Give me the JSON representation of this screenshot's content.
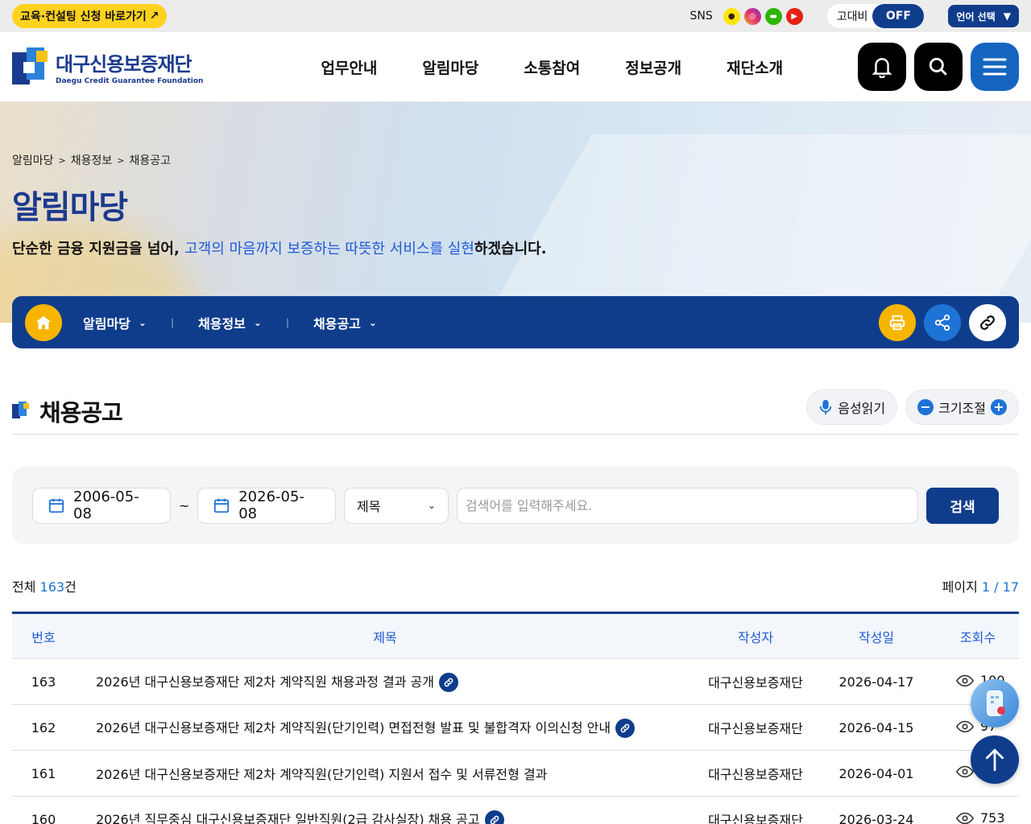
{
  "topbar": {
    "edu_link": "교육·컨설팅 신청 바로가기",
    "sns_label": "SNS",
    "contrast_label": "고대비",
    "contrast_state": "OFF",
    "language_label": "언어 선택"
  },
  "header": {
    "logo_ko": "대구신용보증재단",
    "logo_en": "Daegu Credit Guarantee Foundation",
    "nav": [
      "업무안내",
      "알림마당",
      "소통참여",
      "정보공개",
      "재단소개"
    ]
  },
  "hero": {
    "breadcrumb": [
      "알림마당",
      "채용정보",
      "채용공고"
    ],
    "title": "알림마당",
    "subtitle_pre": "단순한 금융 지원금을 넘어, ",
    "subtitle_highlight": "고객의 마음까지 보증하는 따뜻한 서비스를 실현",
    "subtitle_post": "하겠습니다."
  },
  "location": {
    "depth1": "알림마당",
    "depth2": "채용정보",
    "depth3": "채용공고"
  },
  "content": {
    "title": "채용공고",
    "tts_label": "음성읽기",
    "zoom_label": "크기조절"
  },
  "search": {
    "start_date": "2006-05-08",
    "end_date": "2026-05-08",
    "tilde": "~",
    "field": "제목",
    "placeholder": "검색어를 입력해주세요.",
    "button": "검색"
  },
  "meta": {
    "total_label": "전체",
    "total_count": "163",
    "total_unit": "건",
    "page_label": "페이지",
    "page_current": "1",
    "page_sep": " / ",
    "page_total": "17"
  },
  "table": {
    "headers": [
      "번호",
      "제목",
      "작성자",
      "작성일",
      "조회수"
    ],
    "rows": [
      {
        "no": "163",
        "title": "2026년 대구신용보증재단 제2차 계약직원 채용과정 결과 공개",
        "author": "대구신용보증재단",
        "date": "2026-04-17",
        "views": "100"
      },
      {
        "no": "162",
        "title": "2026년 대구신용보증재단 제2차 계약직원(단기인력) 면접전형 발표 및 불합격자 이의신청 안내",
        "author": "대구신용보증재단",
        "date": "2026-04-15",
        "views": "97"
      },
      {
        "no": "161",
        "title": "2026년 대구신용보증재단 제2차 계약직원(단기인력) 지원서 접수 및 서류전형 결과",
        "author": "대구신용보증재단",
        "date": "2026-04-01",
        "views": ""
      },
      {
        "no": "160",
        "title": "2026년 직무중심 대구신용보증재단 일반직원(2급 감사실장) 채용 공고",
        "author": "대구신용보증재단",
        "date": "2026-03-24",
        "views": "753"
      }
    ]
  },
  "colors": {
    "primary": "#0f3d8c",
    "accent_yellow": "#f7b500",
    "link_blue": "#1e73d6"
  }
}
